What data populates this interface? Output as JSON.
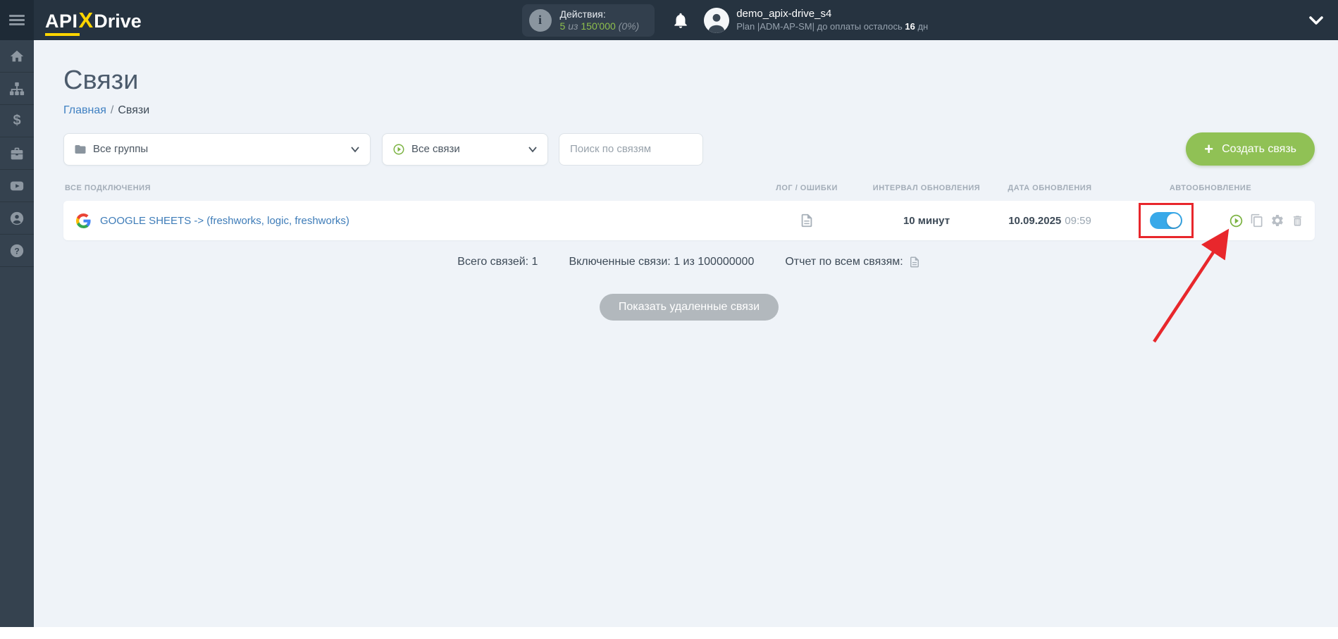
{
  "colors": {
    "topbar_bg": "#263340",
    "sidebar_bg": "#35424f",
    "page_bg": "#eff3f8",
    "logo_yellow": "#ffd500",
    "accent_green": "#90c155",
    "count_green": "#8fbf4d",
    "toggle_blue": "#39a9e9",
    "highlight_red": "#e8272c",
    "link_blue": "#3e7cb8"
  },
  "icons": {
    "dollar": "$",
    "question": "?",
    "info": "i",
    "plus": "+"
  },
  "topbar": {
    "logo": {
      "part1": "API",
      "part2": "X",
      "part3": "Drive"
    },
    "actions": {
      "label": "Действия:",
      "used": "5",
      "of_word": "из",
      "total": "150'000",
      "percent": "(0%)"
    },
    "user": {
      "name": "demo_apix-drive_s4",
      "plan_prefix": "Plan |ADM-AP-SM| до оплаты осталось",
      "days": "16",
      "days_unit": "дн"
    }
  },
  "sidebar": {
    "items": [
      {
        "name": "home"
      },
      {
        "name": "connections-tree"
      },
      {
        "name": "billing"
      },
      {
        "name": "services"
      },
      {
        "name": "video-tutorials"
      },
      {
        "name": "account"
      },
      {
        "name": "help"
      }
    ]
  },
  "page": {
    "title": "Связи",
    "breadcrumb": {
      "home": "Главная",
      "separator": "/",
      "current": "Связи"
    },
    "filters": {
      "groups_value": "Все группы",
      "links_value": "Все связи",
      "search_placeholder": "Поиск по связям",
      "create_button": "Создать связь"
    },
    "table": {
      "headers": [
        "ВСЕ ПОДКЛЮЧЕНИЯ",
        "ЛОГ / ОШИБКИ",
        "ИНТЕРВАЛ ОБНОВЛЕНИЯ",
        "ДАТА ОБНОВЛЕНИЯ",
        "АВТООБНОВЛЕНИЕ"
      ],
      "rows": [
        {
          "name": "GOOGLE SHEETS -> (freshworks, logic, freshworks)",
          "interval": "10 минут",
          "date": "10.09.2025",
          "time": "09:59",
          "auto_update_on": true
        }
      ]
    },
    "summary": {
      "total": "Всего связей: 1",
      "enabled": "Включенные связи: 1 из 100000000",
      "report_label": "Отчет по всем связям:"
    },
    "show_deleted_button": "Показать удаленные связи"
  }
}
